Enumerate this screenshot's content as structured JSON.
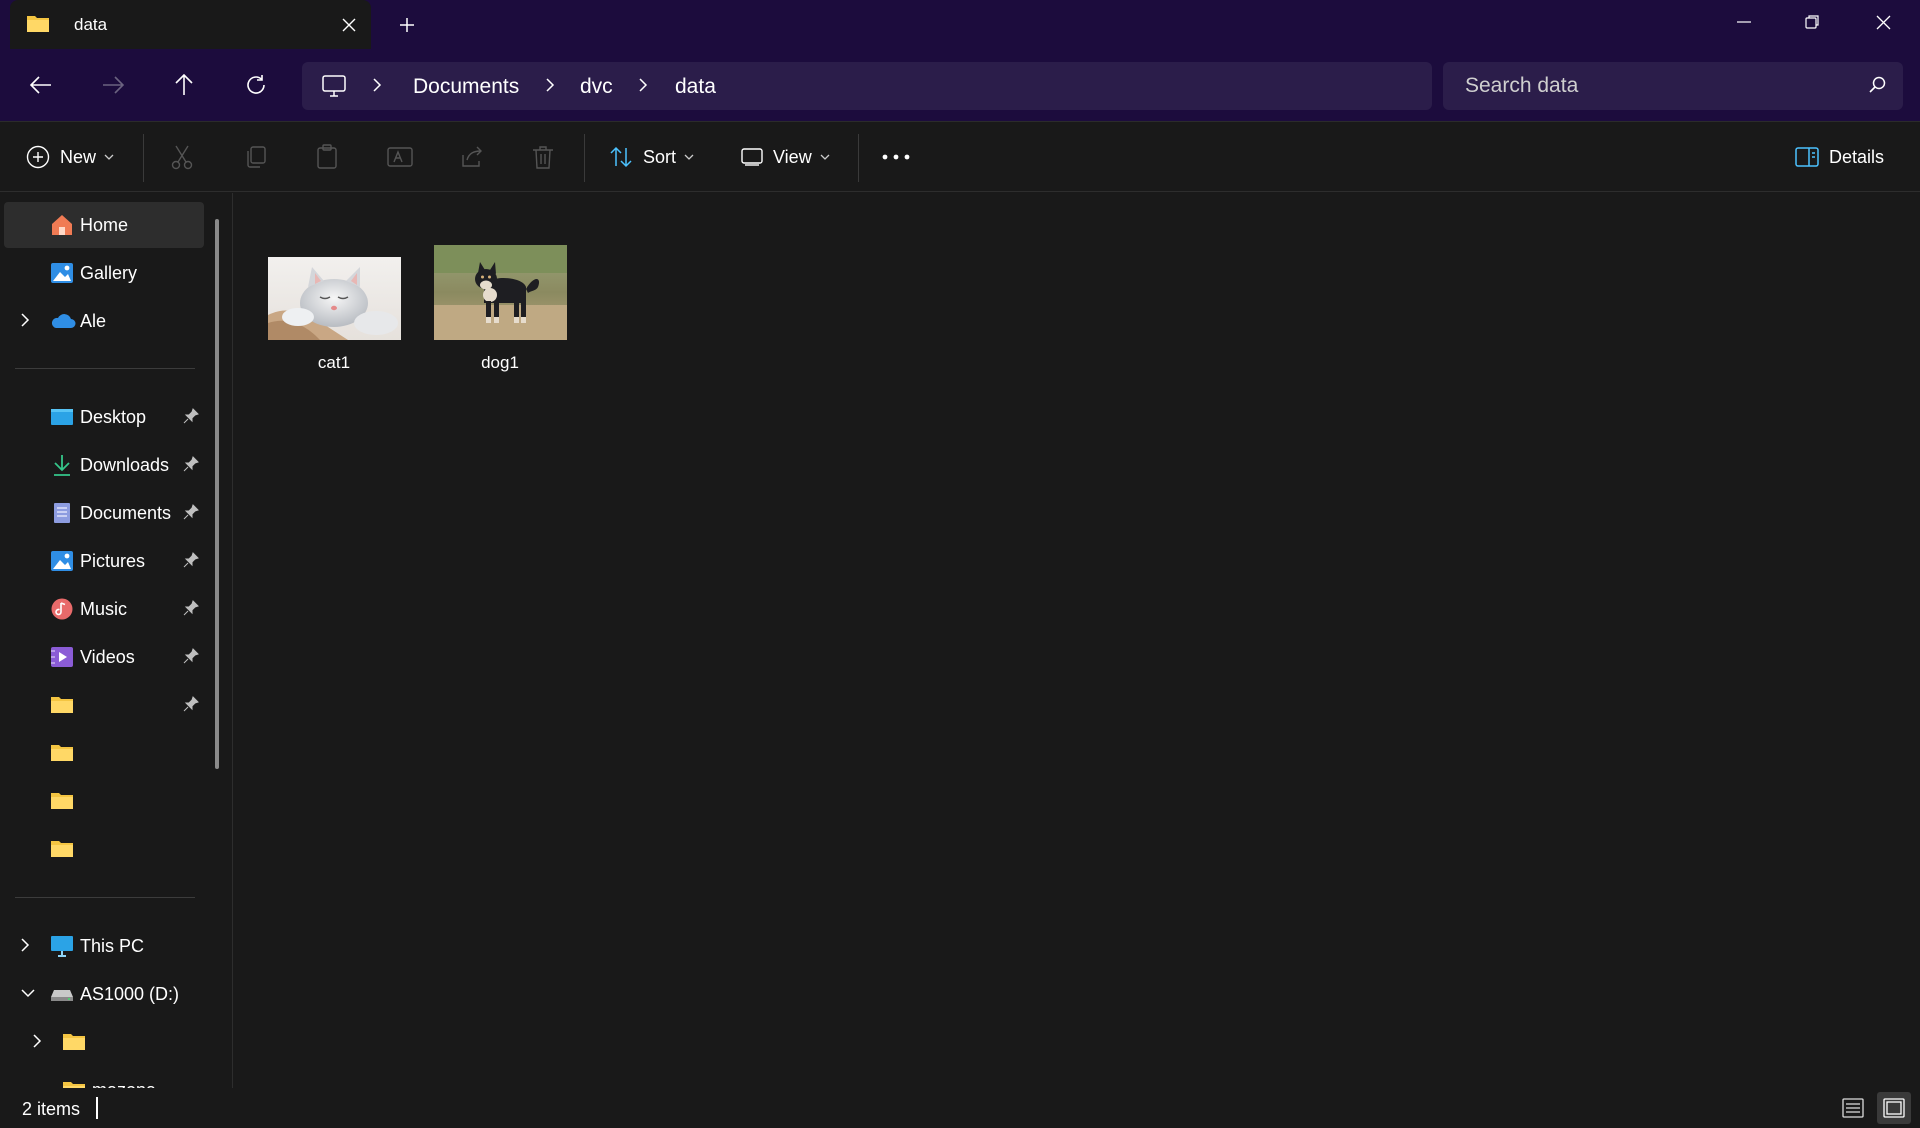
{
  "window": {
    "tab_title": "data",
    "new_tab": "+"
  },
  "nav": {
    "breadcrumbs": [
      "Documents",
      "dvc",
      "data"
    ],
    "search_placeholder": "Search data"
  },
  "toolbar": {
    "new_label": "New",
    "sort_label": "Sort",
    "view_label": "View",
    "details_label": "Details"
  },
  "sidebar": {
    "home": "Home",
    "gallery": "Gallery",
    "onedrive": "Ale",
    "desktop": "Desktop",
    "downloads": "Downloads",
    "documents": "Documents",
    "pictures": "Pictures",
    "music": "Music",
    "videos": "Videos",
    "this_pc": "This PC",
    "drive_d": "AS1000 (D:)",
    "partial_folder": "mazona"
  },
  "files": [
    {
      "name": "cat1",
      "icon": "cat-photo-thumbnail"
    },
    {
      "name": "dog1",
      "icon": "dog-photo-thumbnail"
    }
  ],
  "status": {
    "item_count": "2 items"
  },
  "colors": {
    "titlebar_bg": "#1c0c3d",
    "address_bg": "#2b1d4a",
    "window_bg": "#191919",
    "folder_yellow": "#f4c542",
    "accent_blue": "#4cc2ff"
  }
}
